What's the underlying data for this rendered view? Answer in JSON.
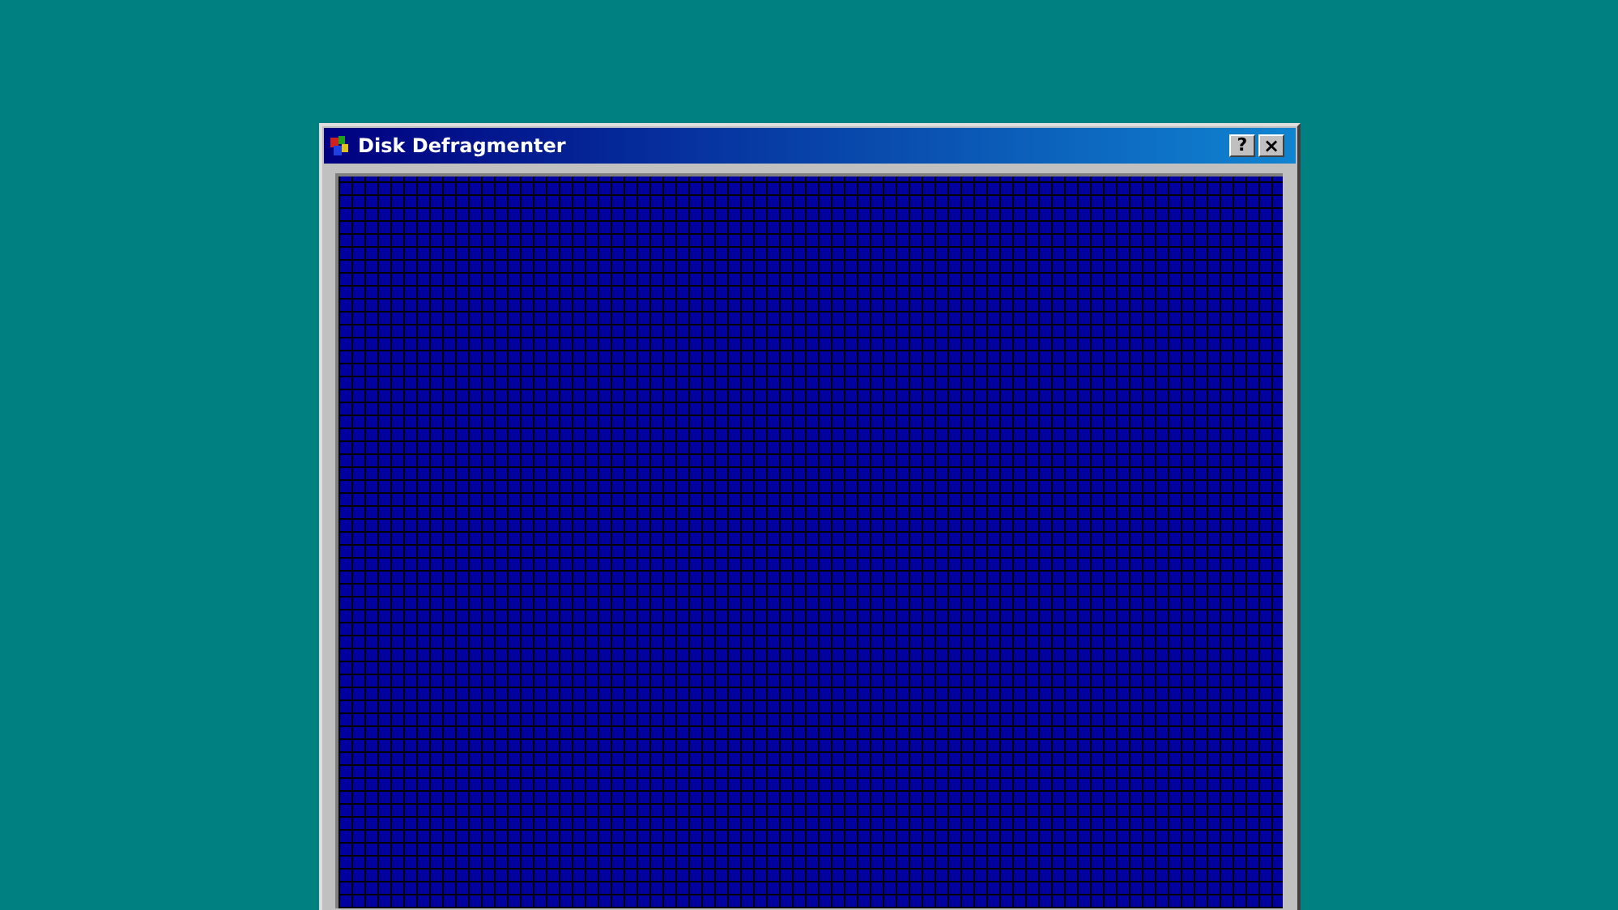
{
  "window": {
    "title": "Disk Defragmenter",
    "buttons": [
      {
        "kind": "help",
        "label": "?"
      },
      {
        "kind": "close",
        "label": "×"
      }
    ]
  }
}
